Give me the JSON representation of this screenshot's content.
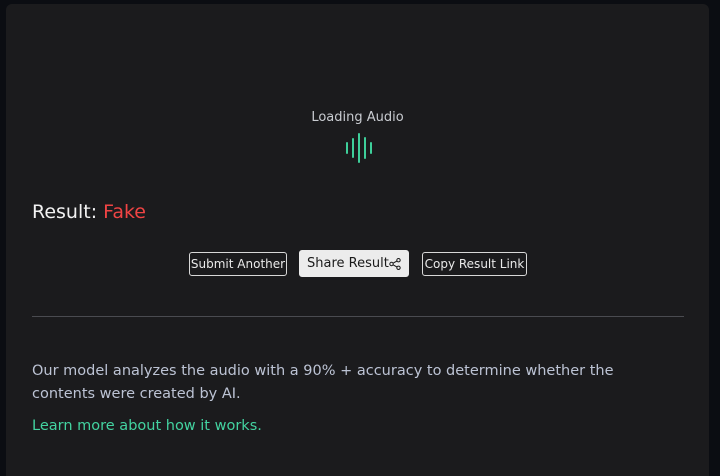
{
  "loading": {
    "label": "Loading Audio",
    "icon": "audio-waveform-icon",
    "color": "#3ecf9a"
  },
  "result": {
    "label": "Result:",
    "value": "Fake",
    "value_color": "#f04444"
  },
  "actions": {
    "submit_label": "Submit Another",
    "share_label": "Share Result",
    "share_icon": "share-icon",
    "copy_label": "Copy Result Link"
  },
  "description": "Our model analyzes the audio with a 90% + accuracy to determine whether the contents were created by AI.",
  "learn_more": {
    "label": "Learn more about how it works.",
    "color": "#43d3a0"
  }
}
